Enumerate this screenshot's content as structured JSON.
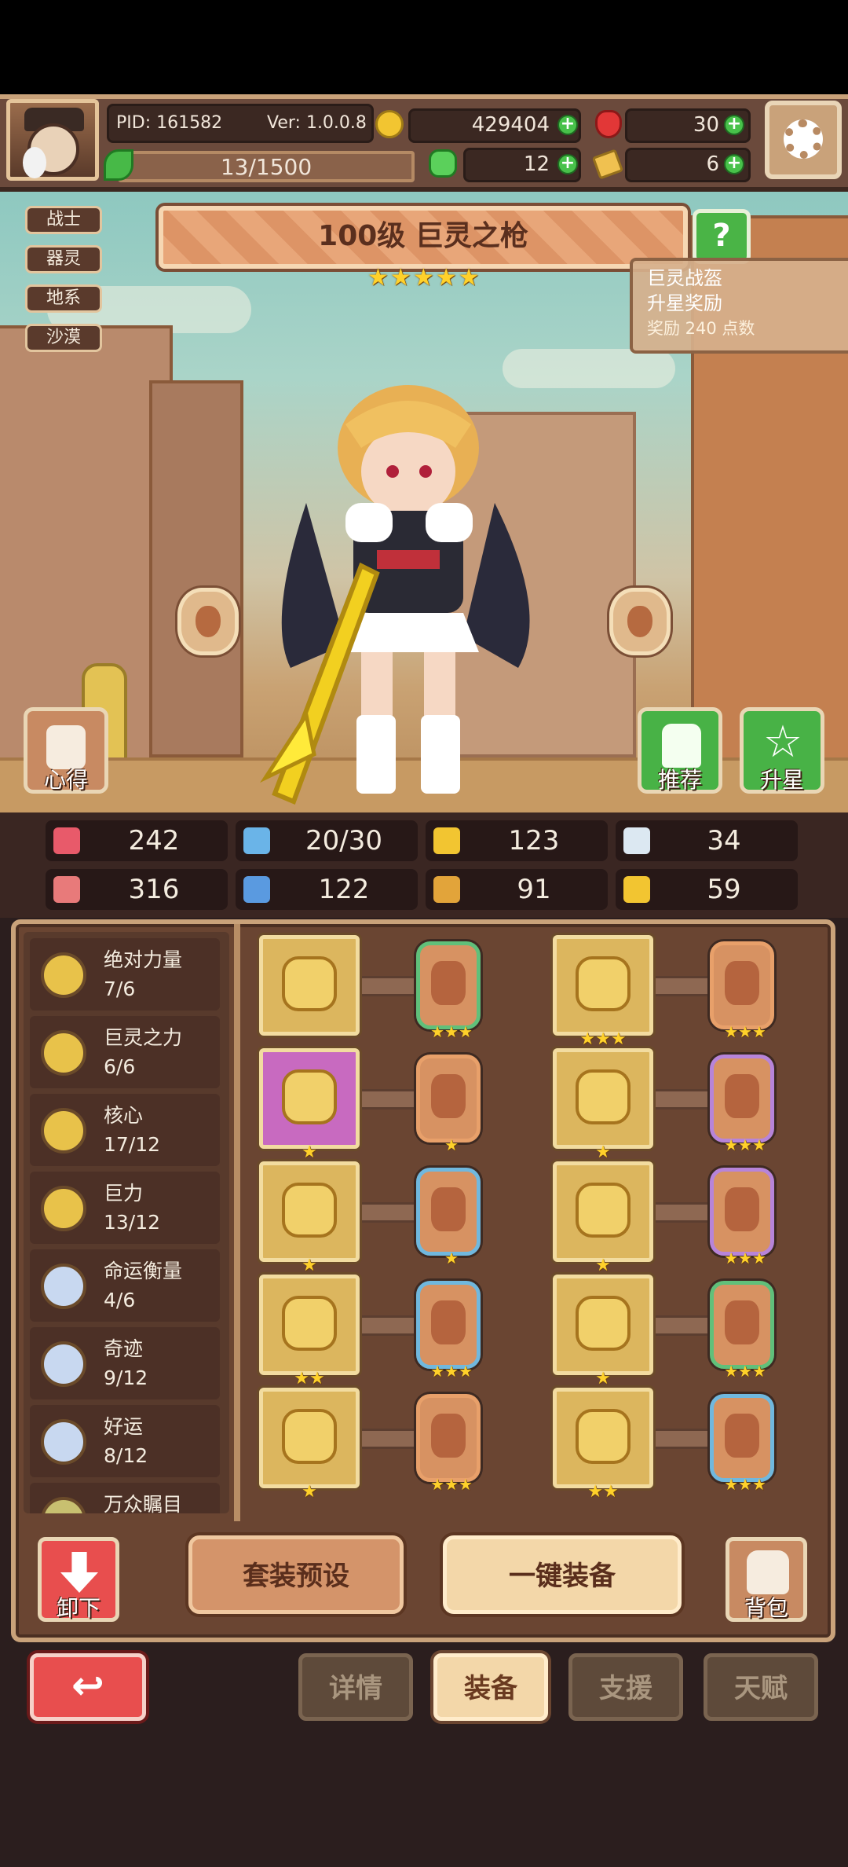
{
  "header": {
    "pid": "PID: 161582",
    "version": "Ver: 1.0.0.8",
    "gold": "429404",
    "gems": "30",
    "energy": "13/1500",
    "clover": "12",
    "fragments": "6"
  },
  "tags": [
    "战士",
    "器灵",
    "地系",
    "沙漠"
  ],
  "hero": {
    "title": "100级 巨灵之枪",
    "star_count": 5,
    "help_icon": "?"
  },
  "tooltip": {
    "line1": "巨灵战盔",
    "line2": "升星奖励",
    "line3": "奖励 240 点数"
  },
  "scene_buttons": {
    "insight": "心得",
    "recommend": "推荐",
    "star_up": "升星"
  },
  "stats": [
    {
      "icon": "heart-icon",
      "value": "242",
      "color": "#e85a6a"
    },
    {
      "icon": "mana-drop-icon",
      "value": "20/30",
      "color": "#6ab4e8"
    },
    {
      "icon": "shield-icon",
      "value": "123",
      "color": "#f2c531"
    },
    {
      "icon": "wing-icon",
      "value": "34",
      "color": "#dce8f2"
    },
    {
      "icon": "fist-icon",
      "value": "316",
      "color": "#e87a7a"
    },
    {
      "icon": "book-icon",
      "value": "122",
      "color": "#5a9ae0"
    },
    {
      "icon": "banner-icon",
      "value": "91",
      "color": "#e2a43a"
    },
    {
      "icon": "horseshoe-icon",
      "value": "59",
      "color": "#f2c531"
    }
  ],
  "sets": [
    {
      "name": "绝对力量",
      "progress": "7/6",
      "medal": "#e8c24a"
    },
    {
      "name": "巨灵之力",
      "progress": "6/6",
      "medal": "#e8c24a"
    },
    {
      "name": "核心",
      "progress": "17/12",
      "medal": "#e8c24a"
    },
    {
      "name": "巨力",
      "progress": "13/12",
      "medal": "#e8c24a"
    },
    {
      "name": "命运衡量",
      "progress": "4/6",
      "medal": "#c8d8f0"
    },
    {
      "name": "奇迹",
      "progress": "9/12",
      "medal": "#c8d8f0"
    },
    {
      "name": "好运",
      "progress": "8/12",
      "medal": "#c8d8f0"
    },
    {
      "name": "万众瞩目",
      "progress": "",
      "medal": "#c8c070"
    }
  ],
  "equipment_rows": [
    {
      "left": {
        "item": "spear-icon",
        "stars": "",
        "rare": false,
        "card": "green",
        "card_stars": "★★★"
      },
      "right": {
        "item": "helmet-icon",
        "stars": "★★★",
        "card": "orange",
        "card_stars": "★★★"
      }
    },
    {
      "left": {
        "item": "compass-gem-icon",
        "stars": "★",
        "rare": true,
        "card": "orange",
        "card_stars": "★"
      },
      "right": {
        "item": "armor-icon",
        "stars": "★",
        "card": "purple",
        "card_stars": "★★★"
      }
    },
    {
      "left": {
        "item": "necklace-icon",
        "stars": "★",
        "rare": false,
        "card": "blue",
        "card_stars": "★"
      },
      "right": {
        "item": "gauntlet-icon",
        "stars": "★",
        "card": "purple",
        "card_stars": "★★★"
      }
    },
    {
      "left": {
        "item": "amulet-icon",
        "stars": "★★",
        "rare": false,
        "card": "blue",
        "card_stars": "★★★"
      },
      "right": {
        "item": "belt-icon",
        "stars": "★",
        "card": "green",
        "card_stars": "★★★"
      }
    },
    {
      "left": {
        "item": "ring-icon",
        "stars": "★",
        "rare": false,
        "card": "orange",
        "card_stars": "★★★"
      },
      "right": {
        "item": "boots-icon",
        "stars": "★★",
        "card": "blue",
        "card_stars": "★★★"
      }
    }
  ],
  "actions": {
    "unequip": "卸下",
    "preset": "套装预设",
    "auto_equip": "一键装备",
    "bag": "背包"
  },
  "nav": {
    "back": "↩",
    "tabs": [
      "详情",
      "装备",
      "支援",
      "天赋"
    ],
    "active": 1
  }
}
